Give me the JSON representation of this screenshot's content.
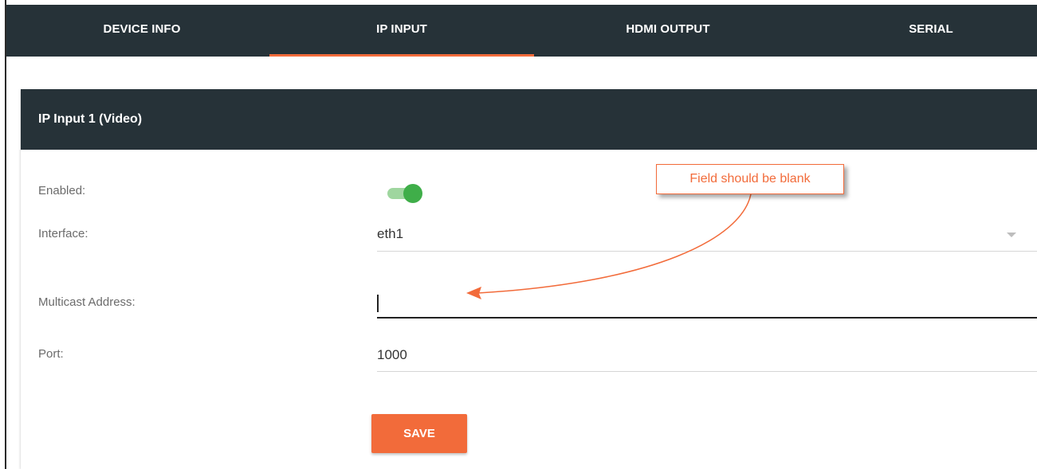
{
  "tabs": [
    {
      "label": "DEVICE INFO",
      "active": false
    },
    {
      "label": "IP INPUT",
      "active": true
    },
    {
      "label": "HDMI OUTPUT",
      "active": false
    },
    {
      "label": "SERIAL",
      "active": false
    }
  ],
  "card": {
    "title": "IP Input 1 (Video)",
    "fields": {
      "enabled": {
        "label": "Enabled:",
        "value": true
      },
      "interface": {
        "label": "Interface:",
        "value": "eth1"
      },
      "multicast": {
        "label": "Multicast Address:",
        "value": ""
      },
      "port": {
        "label": "Port:",
        "value": "1000"
      }
    },
    "save_label": "SAVE"
  },
  "annotation": {
    "text": "Field should be blank"
  },
  "colors": {
    "header_bg": "#263238",
    "accent": "#f26b3a",
    "toggle_on": "#3fae49"
  },
  "icons": {
    "interface_dropdown": "chevron-down-icon"
  }
}
